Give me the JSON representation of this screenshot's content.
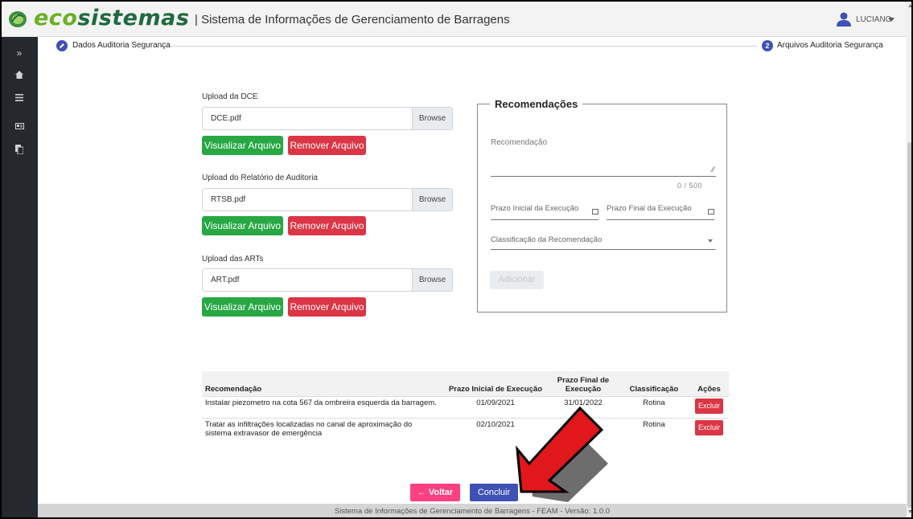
{
  "header": {
    "logo_part1": "eco",
    "logo_part2": "sistemas",
    "title": "| Sistema de Informações de Gerenciamento de Barragens",
    "user": "LUCIANO",
    "brand_colors": {
      "eco": "#6ab023",
      "sistemas": "#1f6a3f"
    }
  },
  "sidebar": {
    "items": [
      {
        "icon": "expand-icon"
      },
      {
        "icon": "home-icon"
      },
      {
        "icon": "menu-icon"
      },
      {
        "icon": "id-card-icon"
      },
      {
        "icon": "documents-icon"
      }
    ]
  },
  "stepper": {
    "step1": {
      "number": "",
      "label": "Dados Auditoria Segurança",
      "icon": "pencil-icon"
    },
    "step2": {
      "number": "2",
      "label": "Arquivos Auditoria Segurança"
    }
  },
  "uploads": [
    {
      "label": "Upload da DCE",
      "file": "DCE.pdf",
      "browse": "Browse",
      "view": "Visualizar Arquivo",
      "remove": "Remover Arquivo"
    },
    {
      "label": "Upload do Relatório de Auditoria",
      "file": "RTSB.pdf",
      "browse": "Browse",
      "view": "Visualizar Arquivo",
      "remove": "Remover Arquivo"
    },
    {
      "label": "Upload das ARTs",
      "file": "ART.pdf",
      "browse": "Browse",
      "view": "Visualizar Arquivo",
      "remove": "Remover Arquivo"
    }
  ],
  "recomendacoes": {
    "legend": "Recomendações",
    "textarea_placeholder": "Recomendação",
    "char_count": "0 / 500",
    "prazo_inicial": "Prazo Inicial da Execução",
    "prazo_final": "Prazo Final da Execução",
    "classificacao": "Classificação da Recomendação",
    "add_button": "Adicionar"
  },
  "table": {
    "headers": [
      "Recomendação",
      "Prazo Inicial de Execução",
      "Prazo Final de Execução",
      "Classificação",
      "Ações"
    ],
    "rows": [
      {
        "recomendacao": "Instalar piezometro na cota 567 da ombreira esquerda da barragem.",
        "inicio": "01/09/2021",
        "fim": "31/01/2022",
        "classificacao": "Rotina",
        "acao": "Excluir"
      },
      {
        "recomendacao": "Tratar as infiltrações localizadas no canal de aproximação do sistema extravasor de emergência",
        "inicio": "02/10/2021",
        "fim": "",
        "classificacao": "Rotina",
        "acao": "Excluir"
      }
    ]
  },
  "actions": {
    "back": "← Voltar",
    "finish": "Concluir"
  },
  "footer": "Sistema de Informações de Gerenciamento de Barragens - FEAM - Versão: 1.0.0",
  "annotation": {
    "arrow_color": "#e0171b"
  }
}
